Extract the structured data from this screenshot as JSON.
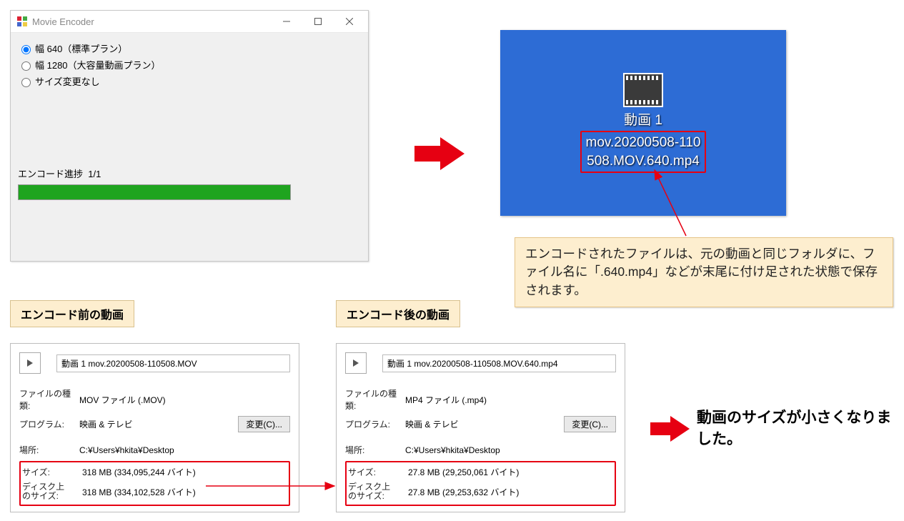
{
  "encoder": {
    "title": "Movie Encoder",
    "options": [
      {
        "label": "幅 640（標準プラン）",
        "selected": true
      },
      {
        "label": "幅 1280（大容量動画プラン）",
        "selected": false
      },
      {
        "label": "サイズ変更なし",
        "selected": false
      }
    ],
    "progress_label": "エンコード進捗",
    "progress_value": "1/1"
  },
  "desktop": {
    "caption": "動画 1",
    "filename_line1": "mov.20200508-110",
    "filename_line2": "508.MOV.640.mp4"
  },
  "callout": "エンコードされたファイルは、元の動画と同じフォルダに、ファイル名に「.640.mp4」などが末尾に付け足された状態で保存されます。",
  "headings": {
    "before": "エンコード前の動画",
    "after": "エンコード後の動画"
  },
  "prop_labels": {
    "filetype": "ファイルの種類:",
    "program": "プログラム:",
    "location": "場所:",
    "size": "サイズ:",
    "disk": "ディスク上\nのサイズ:",
    "change": "変更(C)..."
  },
  "before": {
    "name": "動画 1 mov.20200508-110508.MOV",
    "filetype": "MOV ファイル (.MOV)",
    "program": "映画 & テレビ",
    "location": "C:¥Users¥hkita¥Desktop",
    "size": "318 MB (334,095,244 バイト)",
    "disk": "318 MB (334,102,528 バイト)"
  },
  "after": {
    "name": "動画 1 mov.20200508-110508.MOV.640.mp4",
    "filetype": "MP4 ファイル (.mp4)",
    "program": "映画 & テレビ",
    "location": "C:¥Users¥hkita¥Desktop",
    "size": "27.8 MB (29,250,061 バイト)",
    "disk": "27.8 MB (29,253,632 バイト)"
  },
  "result_text": "動画のサイズが小さくなりました。"
}
